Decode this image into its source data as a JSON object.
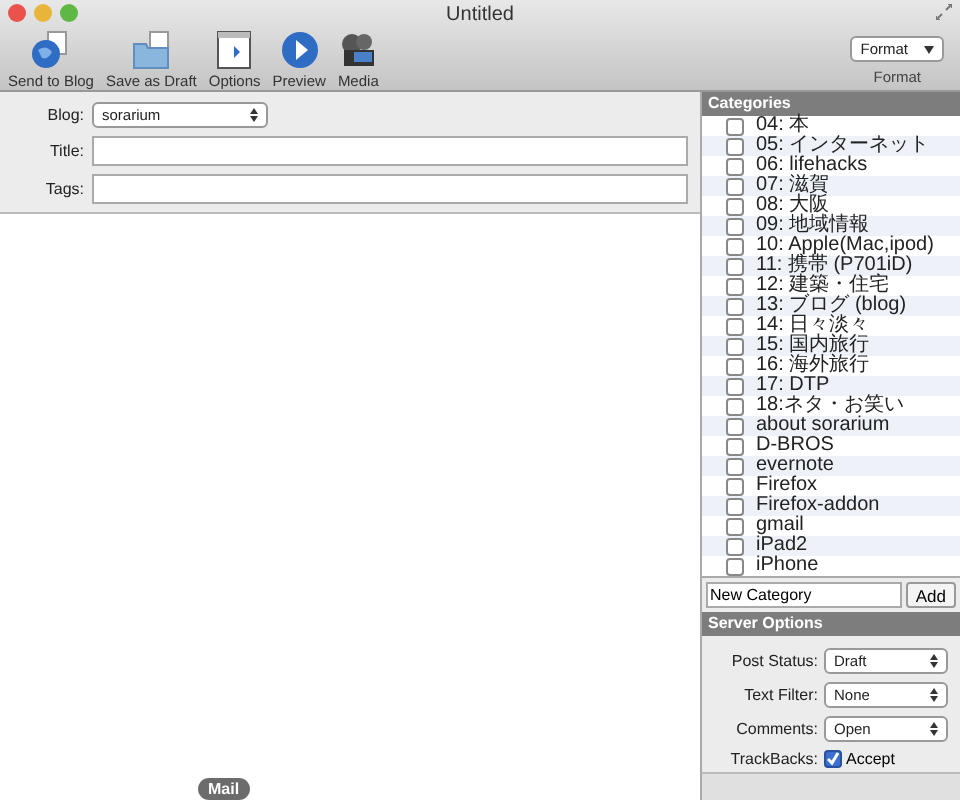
{
  "window": {
    "title": "Untitled"
  },
  "toolbar": [
    {
      "label": "Send to Blog",
      "kind": "globe"
    },
    {
      "label": "Save as Draft",
      "kind": "folder"
    },
    {
      "label": "Options",
      "kind": "panel"
    },
    {
      "label": "Preview",
      "kind": "play"
    },
    {
      "label": "Media",
      "kind": "film"
    }
  ],
  "format": {
    "value": "Format",
    "label": "Format"
  },
  "form": {
    "blog_label": "Blog:",
    "blog_value": "sorarium",
    "title_label": "Title:",
    "tags_label": "Tags:"
  },
  "categories": {
    "title": "Categories",
    "items": [
      {
        "label": "04: 本",
        "checked": false
      },
      {
        "label": "05: インターネット",
        "checked": false
      },
      {
        "label": "06: lifehacks",
        "checked": false
      },
      {
        "label": "07: 滋賀",
        "checked": false
      },
      {
        "label": "08: 大阪",
        "checked": false
      },
      {
        "label": "09: 地域情報",
        "checked": false
      },
      {
        "label": "10: Apple(Mac,ipod)",
        "checked": false
      },
      {
        "label": "11: 携帯 (P701iD)",
        "checked": false
      },
      {
        "label": "12: 建築・住宅",
        "checked": false
      },
      {
        "label": "13: ブログ (blog)",
        "checked": false
      },
      {
        "label": "14: 日々淡々",
        "checked": false
      },
      {
        "label": "15: 国内旅行",
        "checked": false
      },
      {
        "label": "16: 海外旅行",
        "checked": false
      },
      {
        "label": "17: DTP",
        "checked": false
      },
      {
        "label": "18:ネタ・お笑い",
        "checked": false
      },
      {
        "label": "about sorarium",
        "checked": false
      },
      {
        "label": "D-BROS",
        "checked": false
      },
      {
        "label": "evernote",
        "checked": false
      },
      {
        "label": "Firefox",
        "checked": false
      },
      {
        "label": "Firefox-addon",
        "checked": false
      },
      {
        "label": "gmail",
        "checked": false
      },
      {
        "label": "iPad2",
        "checked": false
      },
      {
        "label": "iPhone",
        "checked": false
      }
    ],
    "new_value": "New Category",
    "add_button": "Add"
  },
  "server_options": {
    "title": "Server Options",
    "fields": [
      {
        "label": "Post Status:",
        "value": "Draft"
      },
      {
        "label": "Text Filter:",
        "value": "None"
      },
      {
        "label": "Comments:",
        "value": "Open"
      }
    ],
    "trackbacks": {
      "label": "TrackBacks:",
      "option": "Accept",
      "checked": true
    }
  },
  "dock_tooltip": "Mail"
}
